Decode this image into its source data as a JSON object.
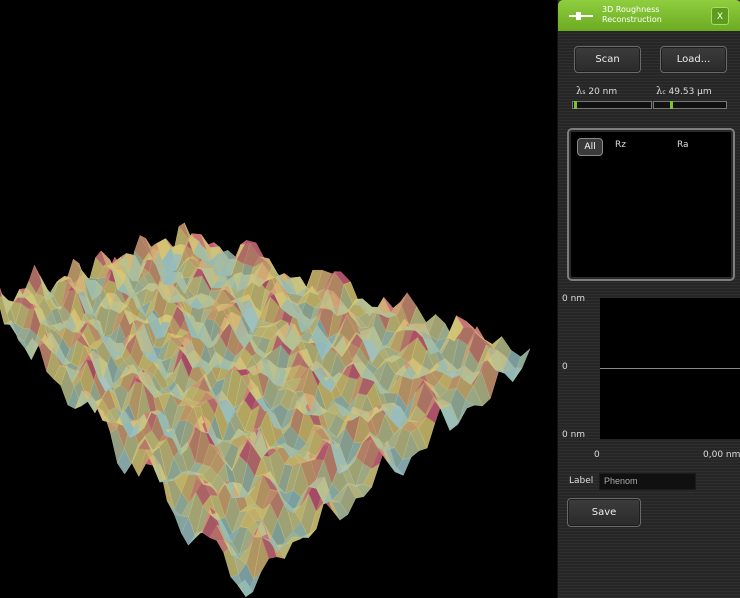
{
  "window": {
    "title": "3D Roughness Reconstruction",
    "close_label": "X"
  },
  "toolbar": {
    "scan_label": "Scan",
    "load_label": "Load..."
  },
  "filters": {
    "lambda_s": {
      "symbol": "λ",
      "subscript": "s",
      "value": "20 nm",
      "slider_fraction": 0.01
    },
    "lambda_c": {
      "symbol": "λ",
      "subscript": "c",
      "value": "49.53 µm",
      "slider_fraction": 0.23
    }
  },
  "results": {
    "all_label": "All",
    "columns": [
      "Rz",
      "Ra"
    ]
  },
  "profile": {
    "y_top": "0 nm",
    "y_mid": "0",
    "y_bottom": "0 nm",
    "x_start": "0",
    "x_end": "0,00 nm"
  },
  "label_field": {
    "label": "Label",
    "value": "Phenom"
  },
  "save_label": "Save",
  "colors": {
    "accent_green": "#7cc232",
    "surface_high": "#c45a78",
    "surface_mid": "#d6c774",
    "surface_low": "#8fb8b8",
    "surface_floor": "#c8d6e0"
  }
}
